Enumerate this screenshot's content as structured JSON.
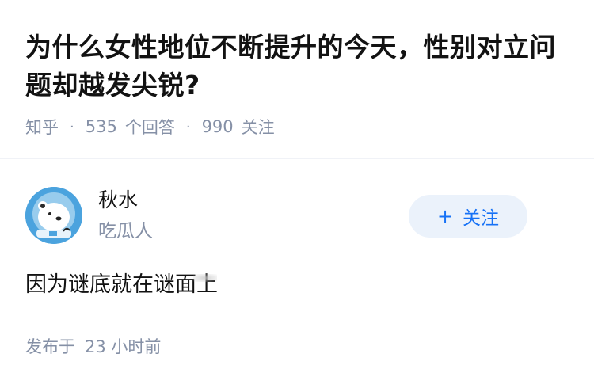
{
  "question": {
    "title": "为什么女性地位不断提升的今天，性别对立问题却越发尖锐?",
    "source": "知乎",
    "answers_count": "535",
    "answers_label": "个回答",
    "followers_count": "990",
    "followers_label": "关注",
    "separator": "·"
  },
  "answer": {
    "author": {
      "name": "秋水",
      "tagline": "吃瓜人",
      "avatar_icon": "polar-bear-astronaut-avatar"
    },
    "follow_button": {
      "icon": "+",
      "label": "关注"
    },
    "content": "因为谜底就在谜面上",
    "publish": {
      "label": "发布于",
      "time": "23 小时前"
    }
  },
  "colors": {
    "accent": "#1772f6",
    "button_bg": "#ebf2fb",
    "meta_text": "#8590a6",
    "body_text": "#121212"
  }
}
